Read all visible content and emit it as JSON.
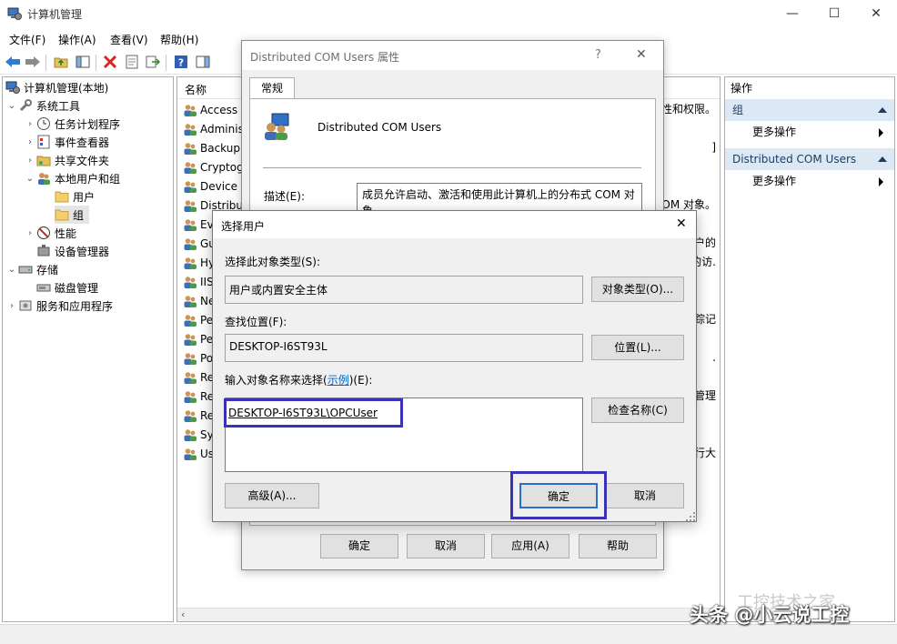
{
  "window": {
    "title": "计算机管理",
    "minimize": "—",
    "maximize": "☐",
    "close": "✕"
  },
  "menu": [
    "文件(F)",
    "操作(A)",
    "查看(V)",
    "帮助(H)"
  ],
  "tree": {
    "root": "计算机管理(本地)",
    "system_tools": "系统工具",
    "task_scheduler": "任务计划程序",
    "event_viewer": "事件查看器",
    "shared_folders": "共享文件夹",
    "local_users_groups": "本地用户和组",
    "users": "用户",
    "groups": "组",
    "performance": "性能",
    "device_manager": "设备管理器",
    "storage": "存储",
    "disk_management": "磁盘管理",
    "services_apps": "服务和应用程序"
  },
  "list": {
    "header_name": "名称",
    "rows": [
      "Access C",
      "Administ",
      "Backup",
      "Cryptog",
      "Device C",
      "Distribut",
      "Eve",
      "Gu",
      "Hy",
      "IIS",
      "Ne",
      "Pe",
      "Pe",
      "Po",
      "Re",
      "Re",
      "Re",
      "Sys",
      "Us"
    ],
    "right_fragments": {
      "r1": "性和权限。",
      "r2": "]",
      "r5": "COM 对象。",
      "r7": "客户的",
      "r8": "的访.",
      "r11": "踪记",
      "r13": ".",
      "r15": "理管理",
      "r18": "执行大"
    }
  },
  "actions": {
    "header": "操作",
    "group1": "组",
    "group1_more": "更多操作",
    "group2": "Distributed COM Users",
    "group2_more": "更多操作"
  },
  "props_dialog": {
    "title": "Distributed COM Users 属性",
    "help": "?",
    "close": "✕",
    "tab": "常规",
    "group_name": "Distributed COM Users",
    "desc_label": "描述(E):",
    "desc_value": "成员允许启动、激活和使用此计算机上的分布式 COM 对象。",
    "ok": "确定",
    "cancel": "取消",
    "apply": "应用(A)",
    "help_button": "帮助"
  },
  "select_dialog": {
    "title": "选择用户",
    "close": "✕",
    "object_type_label": "选择此对象类型(S):",
    "object_type_value": "用户或内置安全主体",
    "object_type_button": "对象类型(O)...",
    "location_label": "查找位置(F):",
    "location_value": "DESKTOP-I6ST93L",
    "location_button": "位置(L)...",
    "names_label_pre": "输入对象名称来选择(",
    "names_label_link": "示例",
    "names_label_post": ")(E):",
    "names_value": "DESKTOP-I6ST93L\\OPCUser",
    "check_names_button": "检查名称(C)",
    "advanced_button": "高级(A)...",
    "ok": "确定",
    "cancel": "取消"
  },
  "watermark": "头条 @小云说工控",
  "watermark2": "工控技术之家",
  "colors": {
    "highlight_box": "#3b33b5",
    "actions_group_bg": "#dde8f5",
    "dialog_border": "#4a7fc0"
  }
}
